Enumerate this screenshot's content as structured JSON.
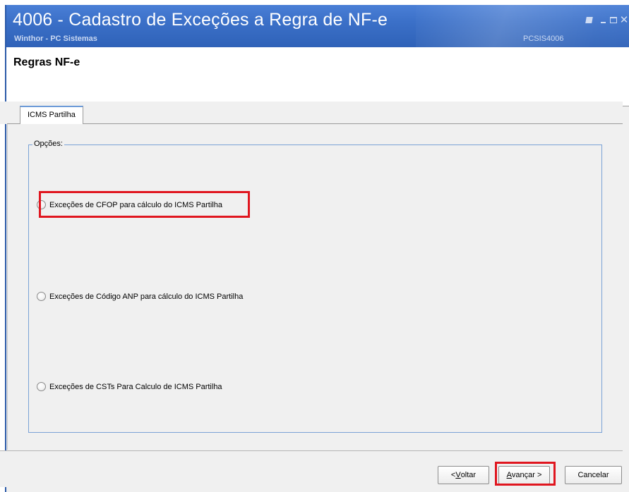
{
  "window": {
    "title": "4006 - Cadastro de Exceções a Regra de NF-e",
    "subtitle": "Winthor - PC Sistemas",
    "code": "PCSIS4006",
    "close_glyph": "✕"
  },
  "header": {
    "heading": "Regras NF-e"
  },
  "tabs": [
    {
      "label": "ICMS Partilha",
      "selected": true
    }
  ],
  "options_group": {
    "legend": "Opções:",
    "options": [
      {
        "label": "Exceções de CFOP para cálculo do ICMS Partilha",
        "checked": false
      },
      {
        "label": "Exceções de Código ANP para cálculo do ICMS Partilha",
        "checked": false
      },
      {
        "label": "Exceções de CSTs Para Calculo de ICMS Partilha",
        "checked": false
      }
    ]
  },
  "buttons": {
    "back_prefix": "< ",
    "back_key": "V",
    "back_rest": "oltar",
    "next_key": "A",
    "next_rest": "vançar >",
    "cancel": "Cancelar"
  },
  "colors": {
    "titlebar": "#3b70c8",
    "highlight": "#e0161f",
    "groupbox_border": "#7aa2d6"
  }
}
